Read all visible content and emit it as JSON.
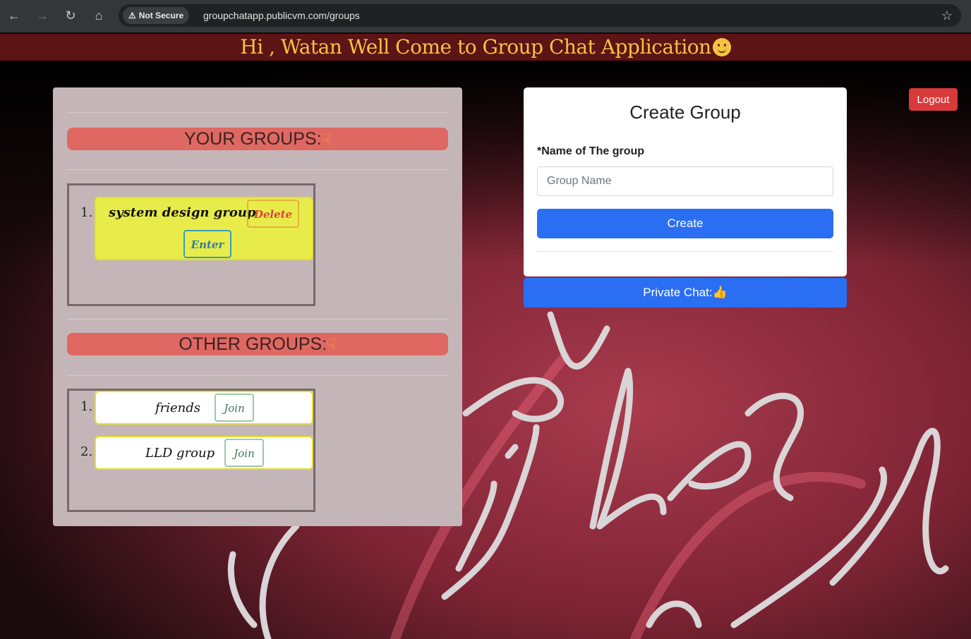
{
  "browser": {
    "security_label": "Not Secure",
    "url": "groupchatapp.publicvm.com/groups",
    "nav_icons": [
      "back-icon",
      "forward-icon",
      "reload-icon",
      "home-icon",
      "warning-icon",
      "star-icon"
    ]
  },
  "greeting": {
    "text": "Hi , Watan Well Come to Group Chat Application"
  },
  "your_groups": {
    "title": "YOUR GROUPS:",
    "items": [
      {
        "number": "1.",
        "name": "system design group",
        "delete_label": "Delete",
        "enter_label": "Enter"
      }
    ]
  },
  "other_groups": {
    "title": "OTHER GROUPS:",
    "items": [
      {
        "number": "1.",
        "name": "friends",
        "join_label": "Join"
      },
      {
        "number": "2.",
        "name": "LLD group",
        "join_label": "Join"
      }
    ]
  },
  "create_group": {
    "title": "Create Group",
    "label": "*Name of The group",
    "placeholder": "Group Name",
    "value": "",
    "button_label": "Create"
  },
  "private_chat": {
    "label": "Private Chat:👍"
  },
  "logout": {
    "label": "Logout"
  },
  "colors": {
    "greeting_bg": "#5c1414",
    "greeting_text": "#f6c243",
    "section_header": "#e06862",
    "primary_button": "#2a6ef2",
    "logout_button": "#d83a3a",
    "your_group_card": "#e8ec4a"
  },
  "background": {
    "neon_text": "good vibes only"
  }
}
